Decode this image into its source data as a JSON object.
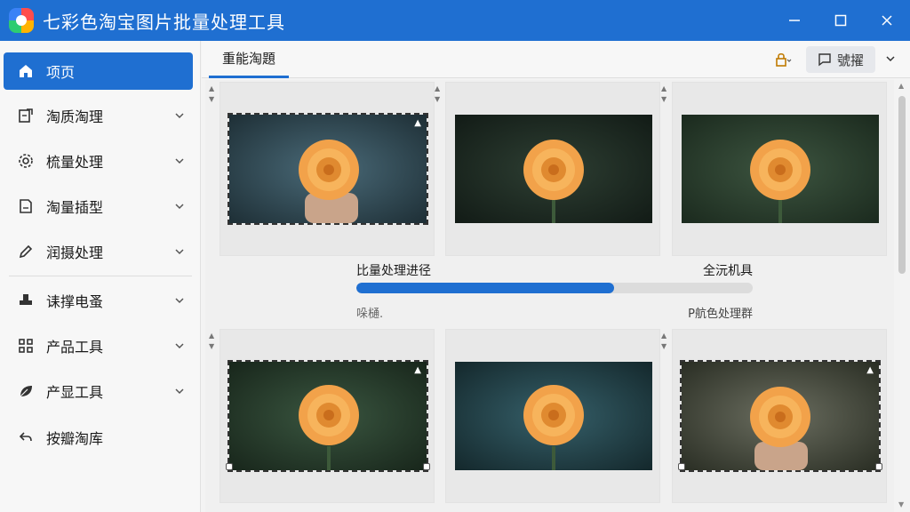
{
  "window": {
    "title": "七彩色淘宝图片批量处理工具",
    "controls": [
      "minimize-icon",
      "maximize-icon",
      "close-icon"
    ]
  },
  "sidebar": {
    "items": [
      {
        "label": "项页",
        "icon": "home-icon",
        "active": true,
        "chevron": false
      },
      {
        "label": "淘质淘理",
        "icon": "edit-doc-icon",
        "active": false,
        "chevron": true
      },
      {
        "label": "梳量处理",
        "icon": "gear-icon",
        "active": false,
        "chevron": true
      },
      {
        "label": "淘量插型",
        "icon": "document-icon",
        "active": false,
        "chevron": true
      },
      {
        "label": "润摄处理",
        "icon": "pen-icon",
        "active": false,
        "chevron": true
      },
      {
        "label": "诔撑电蚤",
        "icon": "stamp-icon",
        "active": false,
        "chevron": true
      },
      {
        "label": "产品工具",
        "icon": "grid-icon",
        "active": false,
        "chevron": true
      },
      {
        "label": "产显工具",
        "icon": "leaf-icon",
        "active": false,
        "chevron": true
      },
      {
        "label": "按瓣淘库",
        "icon": "back-arrow-icon",
        "active": false,
        "chevron": false
      }
    ]
  },
  "toolbar": {
    "active_tab": "重能淘題",
    "lock_icon": "lock-icon",
    "feedback_label": "號擢",
    "feedback_icon": "feedback-icon",
    "more_icon": "chevron-down-icon"
  },
  "progress": {
    "title": "比量处理进径",
    "right_label": "全沅机具",
    "value": 0.65,
    "left_note": "哚樋.",
    "right_note": "P航色处理群"
  },
  "colors": {
    "accent": "#1f6fd1",
    "sidebar_bg": "#f7f7f7",
    "progress_track": "#dcdcdc"
  }
}
